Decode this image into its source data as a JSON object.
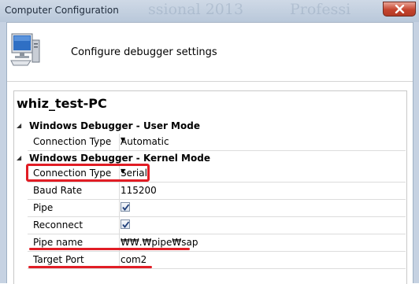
{
  "window": {
    "title": "Computer Configuration",
    "ghost_text_left": "ssional 2013",
    "ghost_text_right": "Professi"
  },
  "header": {
    "heading": "Configure debugger settings"
  },
  "machine_name": "whiz_test-PC",
  "sections": {
    "user_mode": {
      "title": "Windows Debugger - User Mode",
      "connection_type_label": "Connection Type",
      "connection_type_value": "Automatic"
    },
    "kernel_mode": {
      "title": "Windows Debugger - Kernel Mode",
      "connection_type_label": "Connection Type",
      "connection_type_value": "Serial",
      "baud_rate_label": "Baud Rate",
      "baud_rate_value": "115200",
      "pipe_label": "Pipe",
      "pipe_checked": true,
      "reconnect_label": "Reconnect",
      "reconnect_checked": true,
      "pipe_name_label": "Pipe name",
      "pipe_name_value": "₩₩.₩pipe₩sap",
      "target_port_label": "Target Port",
      "target_port_value": "com2"
    }
  },
  "icons": {
    "collapse": "collapse-triangle-icon",
    "dropdown": "dropdown-arrow-icon",
    "computer": "computer-icon",
    "close": "close-icon"
  },
  "colors": {
    "highlight": "#e11d25",
    "titlebar": "#c4d2e3"
  }
}
